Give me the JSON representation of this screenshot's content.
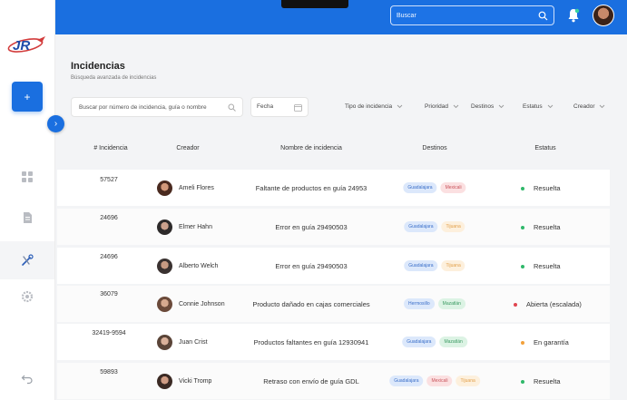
{
  "header": {
    "search_placeholder": "Buscar"
  },
  "page": {
    "title": "Incidencias",
    "subtitle": "Búsqueda avanzada de incidencias"
  },
  "filters": {
    "search_placeholder": "Buscar por número de incidencia, guía o nombre",
    "date_label": "Fecha",
    "type_label": "Tipo de incidencia",
    "priority_label": "Prioridad",
    "destinations_label": "Destinos",
    "status_label": "Estatus",
    "creator_label": "Creador"
  },
  "table": {
    "headers": {
      "id": "# Incidencia",
      "creator": "Creador",
      "name": "Nombre de incidencia",
      "destinations": "Destinos",
      "status": "Estatus"
    },
    "rows": [
      {
        "id": "57527",
        "creator": "Ameli Flores",
        "name": "Faltante de productos en guía 24953",
        "tags": [
          {
            "label": "Guadalajara",
            "color": "blue"
          },
          {
            "label": "Mexicali",
            "color": "red"
          }
        ],
        "status": "Resuelta",
        "status_color": "#2fb86a"
      },
      {
        "id": "24696",
        "creator": "Elmer Hahn",
        "name": "Error en guía 29490503",
        "tags": [
          {
            "label": "Guadalajara",
            "color": "blue"
          },
          {
            "label": "Tijuana",
            "color": "orange"
          }
        ],
        "status": "Resuelta",
        "status_color": "#2fb86a"
      },
      {
        "id": "24696",
        "creator": "Alberto Welch",
        "name": "Error en guía 29490503",
        "tags": [
          {
            "label": "Guadalajara",
            "color": "blue"
          },
          {
            "label": "Tijuana",
            "color": "orange"
          }
        ],
        "status": "Resuelta",
        "status_color": "#2fb86a"
      },
      {
        "id": "36079",
        "creator": "Connie Johnson",
        "name": "Producto dañado en cajas comerciales",
        "tags": [
          {
            "label": "Hermosillo",
            "color": "blue"
          },
          {
            "label": "Mazatlán",
            "color": "green"
          }
        ],
        "status": "Abierta (escalada)",
        "status_color": "#e0454f"
      },
      {
        "id": "32419-9594",
        "creator": "Juan Crist",
        "name": "Productos faltantes en guía 12930941",
        "tags": [
          {
            "label": "Guadalajara",
            "color": "blue"
          },
          {
            "label": "Mazatlán",
            "color": "green"
          }
        ],
        "status": "En garantía",
        "status_color": "#f2a13a"
      },
      {
        "id": "59893",
        "creator": "Vicki Tromp",
        "name": "Retraso con envío de guía GDL",
        "tags": [
          {
            "label": "Guadalajara",
            "color": "blue"
          },
          {
            "label": "Mexicali",
            "color": "red"
          },
          {
            "label": "Tijuana",
            "color": "orange"
          }
        ],
        "status": "Resuelta",
        "status_color": "#2fb86a"
      }
    ]
  },
  "colors": {
    "primary": "#1a6fe0",
    "tag_blue_bg": "#dce8fb",
    "tag_blue_fg": "#3b6fc9",
    "tag_red_bg": "#fbe0e1",
    "tag_red_fg": "#c9545c",
    "tag_orange_bg": "#fdf0dd",
    "tag_orange_fg": "#e2a04b",
    "tag_green_bg": "#dcf3e4",
    "tag_green_fg": "#3b9a62"
  }
}
